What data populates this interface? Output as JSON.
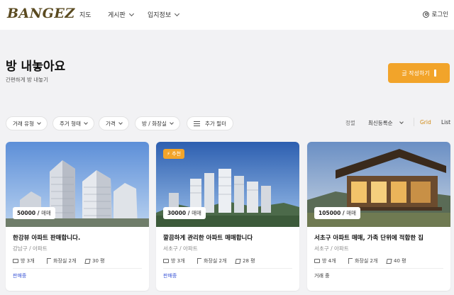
{
  "header": {
    "logo": "BANGEZ",
    "nav": [
      {
        "label": "지도"
      },
      {
        "label": "게시판"
      },
      {
        "label": "입지정보"
      }
    ],
    "login_label": "로그인"
  },
  "page": {
    "title": "방 내놓아요",
    "subtitle": "간편하게 방 내놓기",
    "write_button": "글 작성하기"
  },
  "filters": [
    {
      "label": "거래 유형"
    },
    {
      "label": "주거 형태"
    },
    {
      "label": "가격"
    },
    {
      "label": "방 / 화장실"
    },
    {
      "label": "추가 필터"
    }
  ],
  "sort": {
    "label": "정렬",
    "selected": "최신등록순",
    "view_grid": "Grid",
    "view_list": "List"
  },
  "listings": [
    {
      "price": "50000",
      "deal_type": "매매",
      "badge": "",
      "title": "한강뷰 아파트 판매합니다.",
      "location": "강남구 / 아파트",
      "rooms": "방 3개",
      "bathrooms": "화장실 2개",
      "area": "30 평",
      "status": "판매중",
      "status_color": "#3a55d6"
    },
    {
      "price": "30000",
      "deal_type": "매매",
      "badge": "추천",
      "title": "깔끔하게 관리한 아파트 매매합니다",
      "location": "서초구 / 아파트",
      "rooms": "방 3개",
      "bathrooms": "화장실 2개",
      "area": "28 평",
      "status": "판매중",
      "status_color": "#3a55d6"
    },
    {
      "price": "105000",
      "deal_type": "매매",
      "badge": "",
      "title": "서초구 아파트 매매, 가족 단위에 적합한 집",
      "location": "서초구 / 아파트",
      "rooms": "방 4개",
      "bathrooms": "화장실 2개",
      "area": "40 평",
      "status": "거래 중",
      "status_color": "#333333"
    }
  ],
  "colors": {
    "accent": "#f2a42a",
    "background": "#f2f2f4"
  }
}
